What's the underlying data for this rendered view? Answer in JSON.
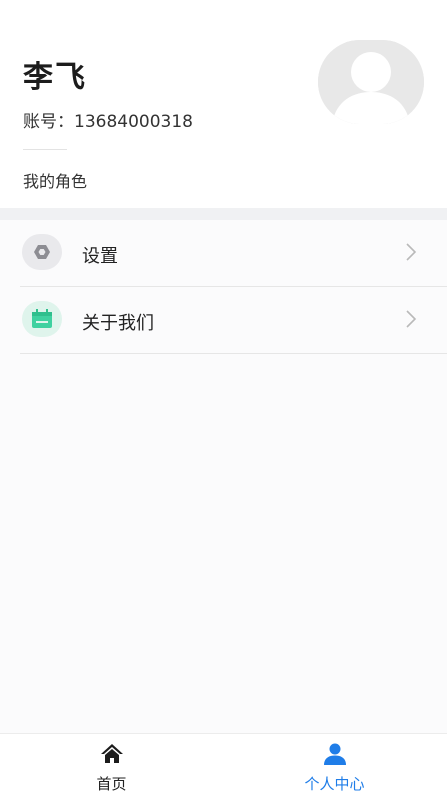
{
  "profile": {
    "name": "李飞",
    "account_label": "账号：",
    "account_number": "13684000318",
    "role_link": "我的角色"
  },
  "menu": {
    "items": [
      {
        "label": "设置",
        "icon": "settings-hexagon-icon",
        "icon_bg": "#e9e9ec"
      },
      {
        "label": "关于我们",
        "icon": "calendar-icon",
        "icon_bg": "#dff4ec"
      }
    ]
  },
  "tabbar": {
    "home_label": "首页",
    "profile_label": "个人中心",
    "active_color": "#1f7de8",
    "inactive_color": "#222222"
  }
}
